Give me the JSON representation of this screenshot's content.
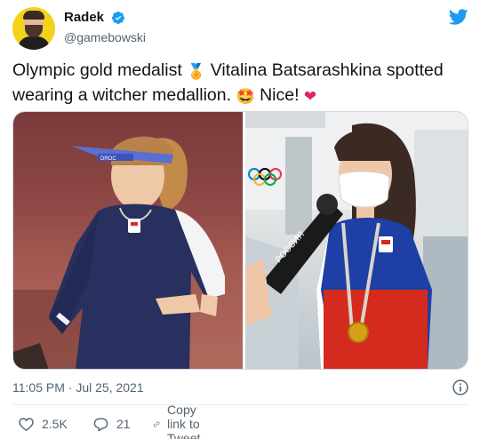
{
  "user": {
    "display_name": "Radek",
    "handle": "@gamebowski"
  },
  "tweet": {
    "line1_a": "Olympic gold medalist",
    "medal_emoji": "🏅",
    "line1_b": "Vitalina Batsarashkina spotted",
    "line2_a": "wearing a witcher medallion.",
    "star_emoji": "🤩",
    "line2_b": "Nice!",
    "heart_emoji": "❤"
  },
  "media": {
    "cap_brand": "DROC",
    "banner_text": "РОССИЯ"
  },
  "meta": {
    "time": "11:05 PM",
    "separator": "·",
    "date": "Jul 25, 2021"
  },
  "actions": {
    "likes": "2.5K",
    "replies": "21",
    "copy_label": "Copy link to Tweet"
  },
  "colors": {
    "twitter_blue": "#1d9bf0",
    "heart_red": "#e0245e",
    "text_secondary": "#536471"
  }
}
